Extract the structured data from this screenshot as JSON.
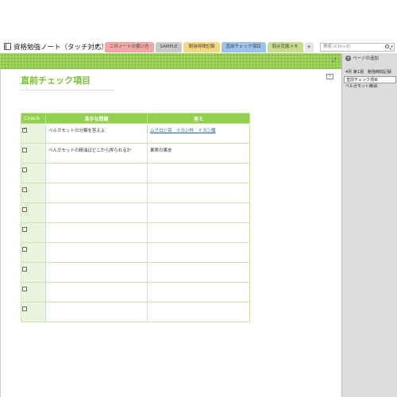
{
  "notebook": {
    "title": "資格勉強ノート（タッチ対応）"
  },
  "sections": [
    {
      "label": "このノートの使い方",
      "color": "#f3a6a6"
    },
    {
      "label": "SAMPLE",
      "color": "#c9c9c9"
    },
    {
      "label": "勉強時間記録",
      "color": "#f6d77c"
    },
    {
      "label": "直前チェック項目",
      "color": "#9cc3ec"
    },
    {
      "label": "弱点克服メモ",
      "color": "#c7dd8a"
    }
  ],
  "search": {
    "placeholder": "検索 (Ctrl+E)"
  },
  "page": {
    "title": "直前チェック項目"
  },
  "table": {
    "headers": [
      "Check",
      "苦手な問題",
      "答え"
    ],
    "rows": [
      {
        "checked": true,
        "question": "ベルガモットの分類を答えよ",
        "answer": "ムクロジ目　ミカン科　ミカン属",
        "answer_link": true
      },
      {
        "checked": false,
        "question": "ベルガモットの精油はどこから搾られるか",
        "answer": "果実の果皮",
        "answer_link": false
      },
      {
        "checked": false,
        "question": "",
        "answer": "",
        "answer_link": false
      },
      {
        "checked": false,
        "question": "",
        "answer": "",
        "answer_link": false
      },
      {
        "checked": false,
        "question": "",
        "answer": "",
        "answer_link": false
      },
      {
        "checked": false,
        "question": "",
        "answer": "",
        "answer_link": false
      },
      {
        "checked": false,
        "question": "",
        "answer": "",
        "answer_link": false
      },
      {
        "checked": false,
        "question": "",
        "answer": "",
        "answer_link": false
      },
      {
        "checked": false,
        "question": "",
        "answer": "",
        "answer_link": false
      },
      {
        "checked": false,
        "question": "",
        "answer": "",
        "answer_link": false
      }
    ]
  },
  "pane": {
    "add_page_label": "ページの追加",
    "pages": [
      {
        "label": "4月 第1週　勉強時間記録",
        "selected": false
      },
      {
        "label": "直前チェック項目",
        "selected": true
      },
      {
        "label": "ベルガモット精油",
        "selected": false
      }
    ]
  },
  "icons": {
    "notebook": "notebook-icon",
    "dropdown": "chevron-down-icon",
    "search": "search-icon",
    "expand": "expand-icon",
    "add_tab": "plus-icon"
  },
  "colors": {
    "accent": "#92d050",
    "title": "#7cbf34",
    "link": "#1e5ea8"
  }
}
